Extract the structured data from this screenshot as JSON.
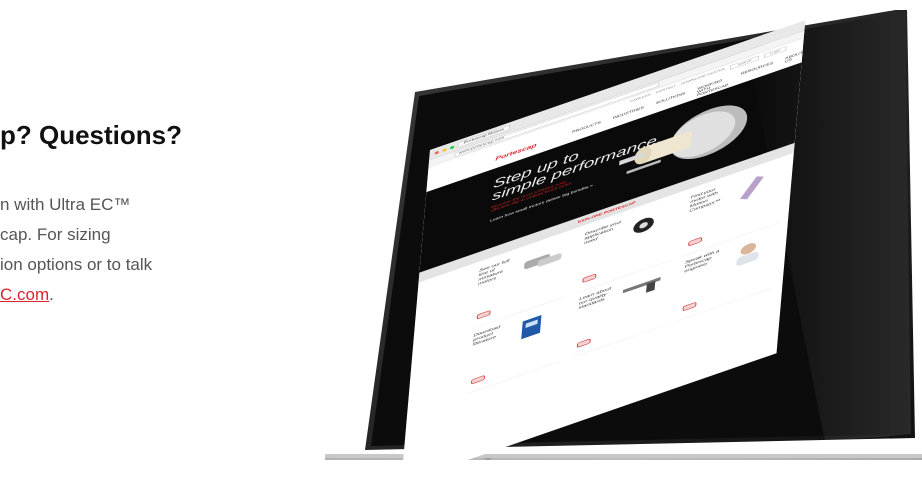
{
  "promo": {
    "heading": "p? Questions?",
    "body_line1": "n with Ultra EC™",
    "body_line2": "cap. For sizing",
    "body_line3": "ion options or to talk",
    "link": "C.com",
    "link_end": "."
  },
  "screen": {
    "browser_tab": "Portescap Motors",
    "address": "www.portescap.com",
    "utility_links": [
      "CAREERS",
      "CONTACT",
      "DOWNLOAD CENTER",
      "Search",
      "Login"
    ],
    "logo": "Portescap",
    "nav": [
      "PRODUCTS",
      "INDUSTRIES",
      "SOLUTIONS",
      "WORKING WITH PORTESCAP",
      "RESOURCES",
      "ABOUT US"
    ],
    "hero_title_1": "Step up to",
    "hero_title_2": "simple performance.",
    "hero_sub": "Discover the most compact, cost-effective slip-in slotless brush motor",
    "hero_cta": "Learn how small motors deliver big benefits >",
    "explore": "EXPLORE PORTESCAP",
    "tiles": [
      "See our full line of miniature motors",
      "Describe your application need",
      "Find your motor with Motion Compass™",
      "Download product literature",
      "Learn about our quality standards",
      "Speak with a Portescap engineer"
    ]
  },
  "colors": {
    "accent": "#d8262c",
    "hero_bg": "#0a0a0a"
  }
}
